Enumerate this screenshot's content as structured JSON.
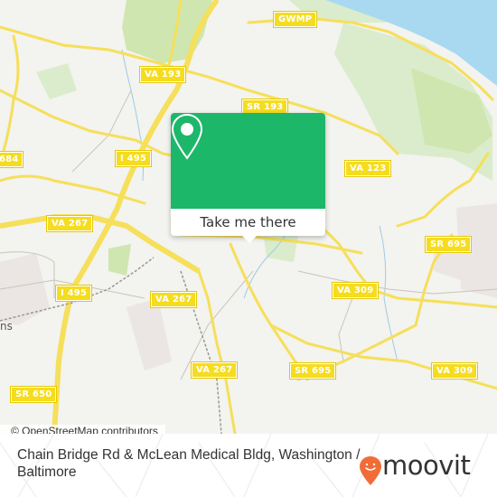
{
  "map": {
    "colors": {
      "land": "#f3f3ef",
      "park": "#cfe6b0",
      "water": "#a9d9f0",
      "road_major": "#f6df5a",
      "road_minor": "#c9c4bd",
      "urban": "#ebe6e3"
    },
    "road_labels": [
      {
        "id": "gwmp",
        "text": "GWMP"
      },
      {
        "id": "va193",
        "text": "VA 193"
      },
      {
        "id": "sr193",
        "text": "SR 193"
      },
      {
        "id": "i495-north",
        "text": "I 495"
      },
      {
        "id": "va123",
        "text": "VA 123"
      },
      {
        "id": "sr684",
        "text": "684"
      },
      {
        "id": "va267-west",
        "text": "VA 267"
      },
      {
        "id": "sr695-east",
        "text": "SR 695"
      },
      {
        "id": "i495-south",
        "text": "I 495"
      },
      {
        "id": "va267-mid",
        "text": "VA 267"
      },
      {
        "id": "va309-mid",
        "text": "VA 309"
      },
      {
        "id": "va267-south",
        "text": "VA 267"
      },
      {
        "id": "sr695-south",
        "text": "SR 695"
      },
      {
        "id": "va309-east",
        "text": "VA 309"
      },
      {
        "id": "sr650",
        "text": "SR 650"
      }
    ],
    "place_labels": [
      {
        "id": "west-edge",
        "text": "ns"
      }
    ],
    "attribution": "© OpenStreetMap contributors"
  },
  "popup": {
    "icon": "location-pin-icon",
    "button_label": "Take me there",
    "color": "#1db76a"
  },
  "footer": {
    "title": "Chain Bridge Rd & McLean Medical Bldg, Washington / Baltimore",
    "brand": "moovit",
    "brand_color": "#f26c37"
  }
}
